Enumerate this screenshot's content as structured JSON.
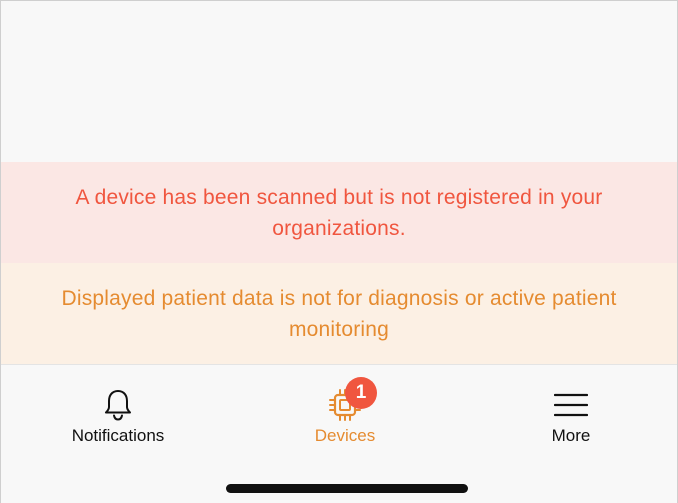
{
  "banners": {
    "error_text": "A device has been scanned but is not registered in your organizations.",
    "warning_text": "Displayed patient data is not for diagnosis or active patient monitoring"
  },
  "tabs": [
    {
      "label": "Notifications",
      "icon": "bell-icon",
      "active": false
    },
    {
      "label": "Devices",
      "icon": "device-chip-icon",
      "active": true,
      "badge": "1"
    },
    {
      "label": "More",
      "icon": "hamburger-menu-icon",
      "active": false
    }
  ],
  "colors": {
    "error_text": "#f0563f",
    "error_bg": "#fbe7e4",
    "warning_text": "#e58b30",
    "warning_bg": "#fcf0e4",
    "badge": "#f0563f"
  }
}
